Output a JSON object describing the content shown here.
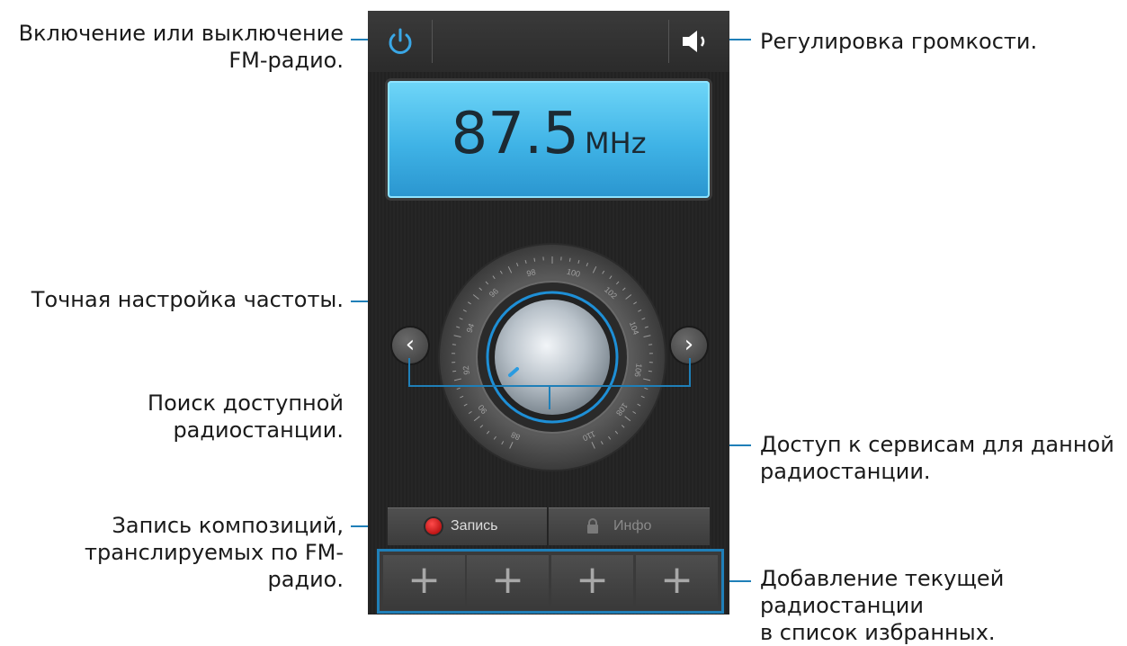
{
  "callouts": {
    "power_line1": "Включение или выключение",
    "power_line2": "FM-радио.",
    "volume": "Регулировка громкости.",
    "fine_tune": "Точная настройка частоты.",
    "search": "Поиск доступной радиостанции.",
    "services_line1": "Доступ к сервисам для данной",
    "services_line2": "радиостанции.",
    "record_line1": "Запись композиций,",
    "record_line2": "транслируемых по FM-радио.",
    "favorites_line1": "Добавление текущей радиостанции",
    "favorites_line2": "в список избранных."
  },
  "display": {
    "frequency": "87.5",
    "unit": "MHz"
  },
  "dial": {
    "ticks": [
      "88",
      "90",
      "92",
      "94",
      "96",
      "98",
      "100",
      "102",
      "104",
      "106",
      "108",
      "110"
    ]
  },
  "buttons": {
    "record_label": "Запись",
    "info_label": "Инфо"
  },
  "favorites": {
    "slots": [
      "+",
      "+",
      "+",
      "+"
    ]
  },
  "icons": {
    "power": "power-icon",
    "volume": "speaker-icon",
    "prev": "chevron-left-icon",
    "next": "chevron-right-icon",
    "lock": "lock-icon"
  },
  "colors": {
    "accent": "#1f7fb8",
    "display": "#4ec3ee",
    "record": "#d01a1a",
    "power": "#3aa7e6"
  }
}
